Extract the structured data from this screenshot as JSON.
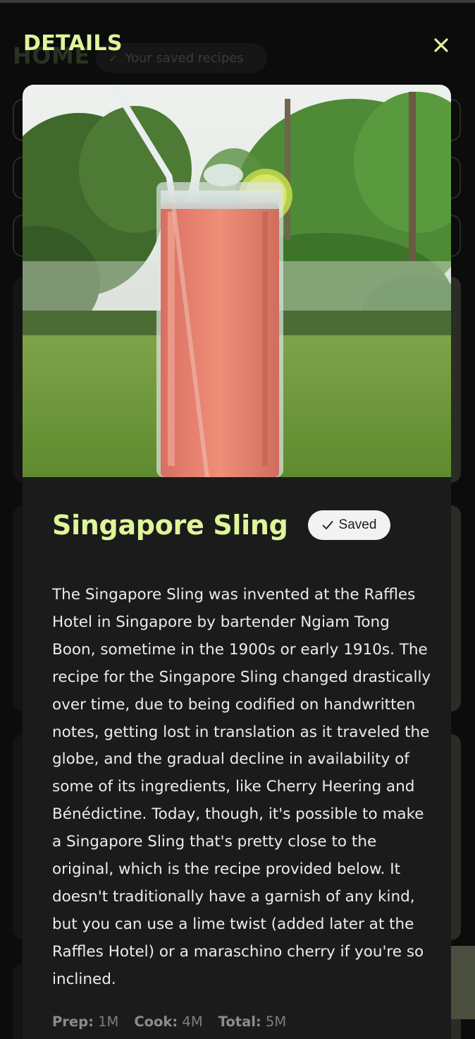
{
  "background": {
    "home_title": "HOME",
    "saved_filter_label": "Your saved recipes"
  },
  "header": {
    "title": "DETAILS",
    "close_icon": "close-icon"
  },
  "recipe": {
    "image_icon": "cocktail-photo",
    "title": "Singapore Sling",
    "saved_badge": "Saved",
    "description": "The Singapore Sling was invented at the Raffles Hotel in Singapore by bartender Ngiam Tong Boon, sometime in the 1900s or early 1910s. The recipe for the Singapore Sling changed drastically over time, due to being codified on handwritten notes, getting lost in translation as it traveled the globe, and the gradual decline in availability of some of its ingredients, like Cherry Heering and Bénédictine. Today, though, it's possible to make a Singapore Sling that's pretty close to the original, which is the recipe provided below. It doesn't traditionally have a garnish of any kind, but you can use a lime twist (added later at the Raffles Hotel) or a maraschino cherry if you're so inclined.",
    "times": [
      {
        "label": "Prep:",
        "value": "1M"
      },
      {
        "label": "Cook:",
        "value": "4M"
      },
      {
        "label": "Total:",
        "value": "5M"
      }
    ]
  },
  "colors": {
    "accent": "#dff59a",
    "modal_bg": "#1b1b1b",
    "page_bg": "#0c0c0c"
  }
}
